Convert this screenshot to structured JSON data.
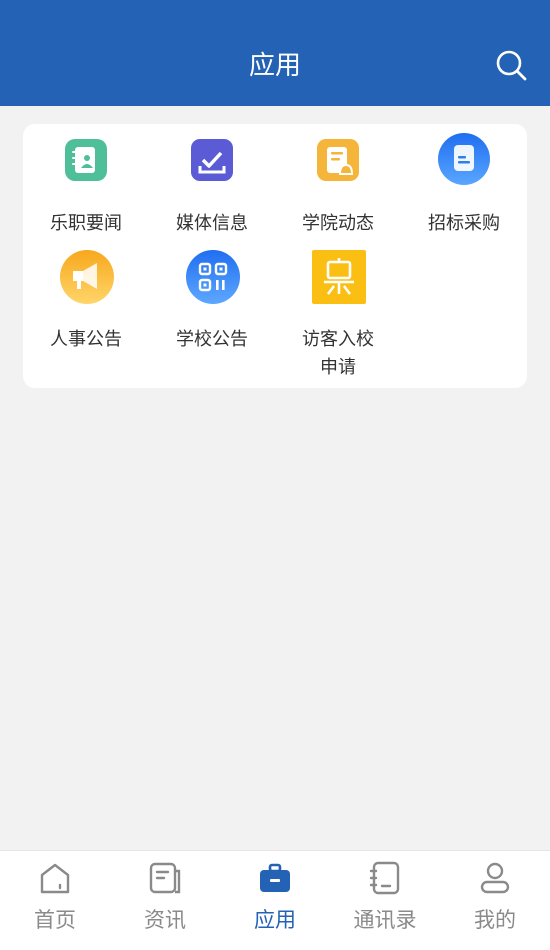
{
  "header": {
    "title": "应用",
    "search_icon": "search-icon"
  },
  "apps": [
    {
      "label": "乐职要闻",
      "icon": "contacts-book-icon",
      "color": "#4fbf9a"
    },
    {
      "label": "媒体信息",
      "icon": "inbox-check-icon",
      "color": "#5b5bd6"
    },
    {
      "label": "学院动态",
      "icon": "document-bell-icon",
      "color": "#f5b53a"
    },
    {
      "label": "招标采购",
      "icon": "document-icon",
      "color": "#2f86f0"
    },
    {
      "label": "人事公告",
      "icon": "megaphone-icon",
      "color": "#f7b21f"
    },
    {
      "label": "学校公告",
      "icon": "qr-code-icon",
      "color": "#2f7ee8"
    },
    {
      "label": "访客入校\n申请",
      "icon": "easel-icon",
      "color": "#fbbf14"
    }
  ],
  "tabs": [
    {
      "label": "首页",
      "icon": "home-icon",
      "active": false
    },
    {
      "label": "资讯",
      "icon": "news-icon",
      "active": false
    },
    {
      "label": "应用",
      "icon": "briefcase-icon",
      "active": true
    },
    {
      "label": "通讯录",
      "icon": "address-book-icon",
      "active": false
    },
    {
      "label": "我的",
      "icon": "user-icon",
      "active": false
    }
  ],
  "colors": {
    "brand": "#2362b4",
    "inactive": "#8a8a8a",
    "background": "#f2f2f2"
  }
}
